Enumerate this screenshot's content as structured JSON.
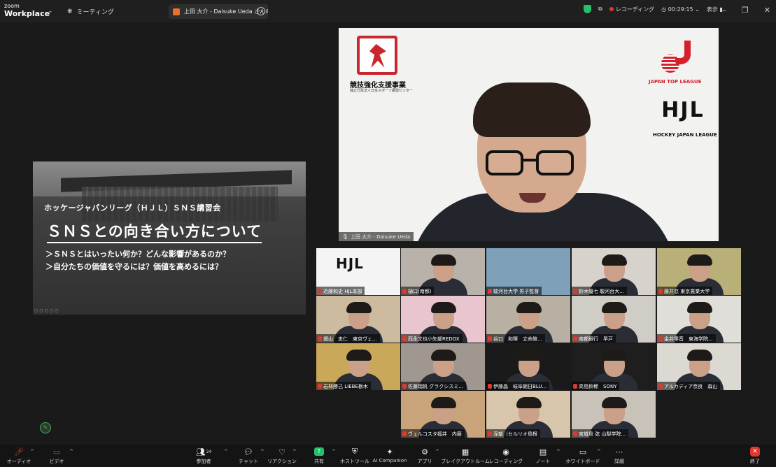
{
  "topbar": {
    "brand_small": "zoom",
    "brand_large": "Workplace",
    "caret": "⌄",
    "meeting_label": "ミーティング",
    "tab_title": "上田 大介 - Daisuke Ueda さんの画",
    "tab_more": "⋯",
    "recording_label": "レコーディング",
    "timer": "00:29:15",
    "view_label": "表示"
  },
  "shared_screen": {
    "subtitle": "ホッケージャパンリーグ（ＨＪＬ）ＳＮＳ講習会",
    "title": "ＳＮＳとの向き合い方について",
    "line1": "＞ＳＮＳとはいったい何か？どんな影響があるのか？",
    "line2": "＞自分たちの価値を守るには？価値を高めるには？"
  },
  "speaker": {
    "org_name": "競技強化支援事業",
    "org_sub": "独立行政法人日本スポーツ振興センター",
    "league1": "JAPAN TOP LEAGUE",
    "league2_logo": "HJL",
    "league2": "HOCKEY JAPAN LEAGUE",
    "name_tag": "上田 大介 - Daisuke Ueda"
  },
  "participants": [
    {
      "name": "近藤和史 HJL本部",
      "bg": "#f4f4f4",
      "has_face": false
    },
    {
      "name": "樋口(南都)",
      "bg": "#b9b2aa",
      "has_face": true
    },
    {
      "name": "駿河台大学 男子監督",
      "bg": "#7ea0b8",
      "has_face": false
    },
    {
      "name": "鈴木優七 駿河台大...",
      "bg": "#d7d2cc",
      "has_face": true
    },
    {
      "name": "藤井恋 東京農業大学",
      "bg": "#b8b078",
      "has_face": true,
      "active": true
    },
    {
      "name": "畑山　忠仁　東京ヴェ...",
      "bg": "#cdbba0",
      "has_face": true
    },
    {
      "name": "西永文也小矢部REDOX",
      "bg": "#e9c6cf",
      "has_face": true
    },
    {
      "name": "谷口　和暉　立命館...",
      "bg": "#b8b0a2",
      "has_face": true
    },
    {
      "name": "南都銀行　早戸",
      "bg": "#d0ccc6",
      "has_face": true
    },
    {
      "name": "金井零音　東海学院...",
      "bg": "#e0ded8",
      "has_face": true
    },
    {
      "name": "岩林勝己 LIEBE栃木",
      "bg": "#c9a85a",
      "has_face": true
    },
    {
      "name": "佐藤瑞帆 グラクシスミ...",
      "bg": "#a09890",
      "has_face": true
    },
    {
      "name": "伊藤晶　岐阜朝日BLU...",
      "bg": "#1a1a1a",
      "has_face": true
    },
    {
      "name": "高島鈴稀　SONY",
      "bg": "#1e1e1e",
      "has_face": true
    },
    {
      "name": "アルカディア奈良　森山",
      "bg": "#dcd8d2",
      "has_face": true
    },
    {
      "name": "ヴェルコスタ福井　内藤",
      "bg": "#c9a47a",
      "has_face": true
    },
    {
      "name": "深部（セルリオ島根",
      "bg": "#d8c6ac",
      "has_face": true
    },
    {
      "name": "宮城島 弦 山梨学院...",
      "bg": "#c8c2b8",
      "has_face": true
    }
  ],
  "toolbar": {
    "audio": "オーディオ",
    "video": "ビデオ",
    "participants": "参加者",
    "participants_count": "24",
    "chat": "チャット",
    "reactions": "リアクション",
    "share": "共有",
    "host_tools": "ホストツール",
    "ai": "AI Companion",
    "apps": "アプリ",
    "breakout": "ブレイクアウトルーム",
    "record": "レコーディング",
    "notes": "ノート",
    "whiteboard": "ホワイトボード",
    "more": "詳細",
    "end": "終了",
    "caret": "^"
  }
}
